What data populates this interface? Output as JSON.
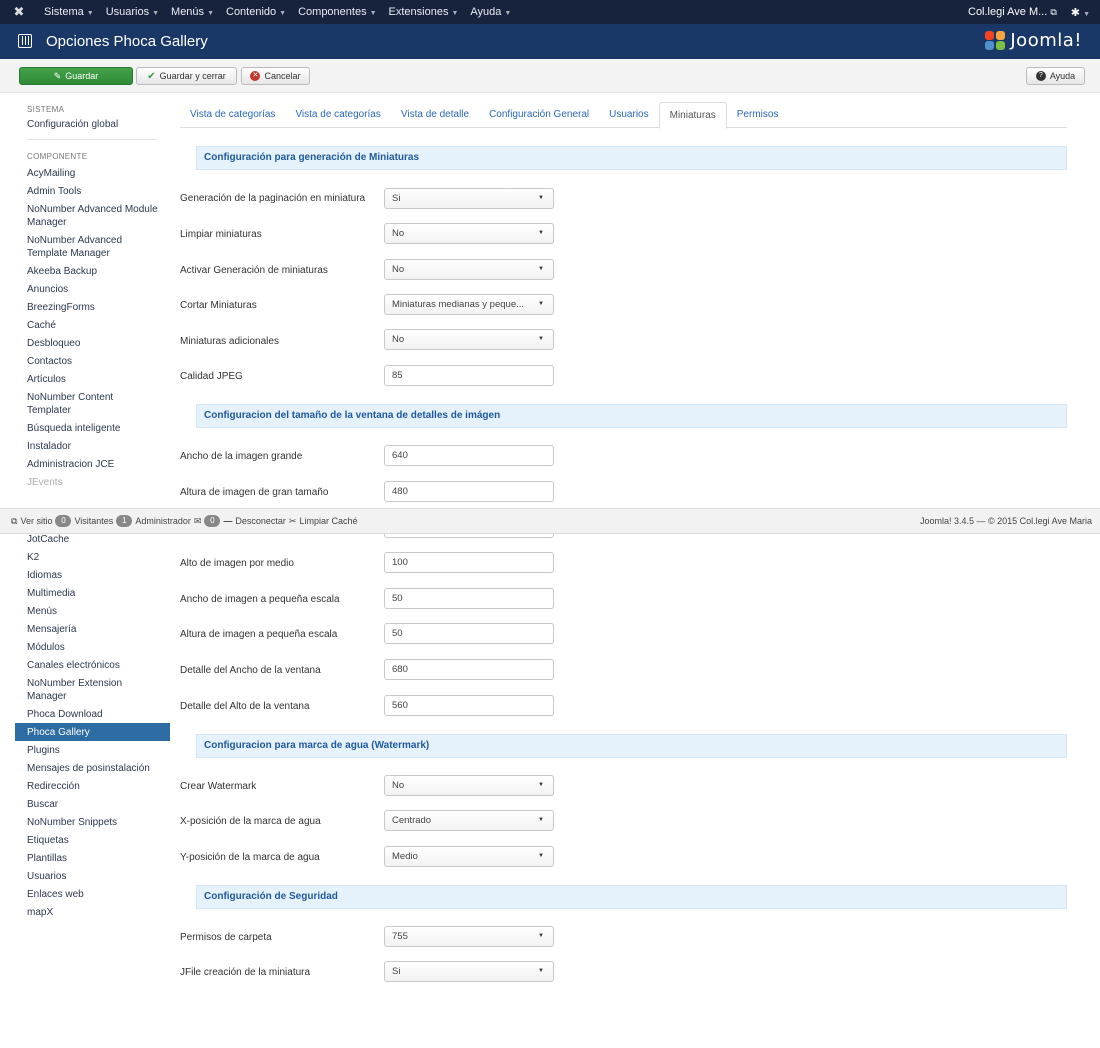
{
  "navbar": {
    "menu": [
      "Sistema",
      "Usuarios",
      "Menús",
      "Contenido",
      "Componentes",
      "Extensiones",
      "Ayuda"
    ],
    "site_name": "Col.legi Ave M...",
    "site_icon": "external-link-icon",
    "settings_icon": "gear-icon"
  },
  "header": {
    "title": "Opciones Phoca Gallery",
    "logo_text": "Joomla!"
  },
  "toolbar": {
    "save": "Guardar",
    "save_close": "Guardar y cerrar",
    "cancel": "Cancelar",
    "help": "Ayuda"
  },
  "sidebar": {
    "system_heading": "SISTEMA",
    "system_items": [
      "Configuración global"
    ],
    "component_heading": "COMPONENTE",
    "items_top": [
      "AcyMailing",
      "Admin Tools",
      "NoNumber Advanced Module Manager",
      "NoNumber Advanced Template Manager",
      "Akeeba Backup",
      "Anuncios",
      "BreezingForms",
      "Caché",
      "Desbloqueo",
      "Contactos",
      "Artículos",
      "NoNumber Content Templater",
      "Búsqueda inteligente",
      "Instalador",
      "Administracion JCE",
      "JEvents"
    ],
    "items_bottom": [
      "JotCache",
      "K2",
      "Idiomas",
      "Multimedia",
      "Menús",
      "Mensajería",
      "Módulos",
      "Canales electrónicos",
      "NoNumber Extension Manager",
      "Phoca Download",
      "Phoca Gallery",
      "Plugins",
      "Mensajes de posinstalación",
      "Redirección",
      "Buscar",
      "NoNumber Snippets",
      "Etiquetas",
      "Plantillas",
      "Usuarios",
      "Enlaces web",
      "mapX"
    ],
    "active": "Phoca Gallery"
  },
  "tabs": [
    "Vista de categorías",
    "Vista de categorías",
    "Vista de detalle",
    "Configuración General",
    "Usuarios",
    "Miniaturas",
    "Permisos"
  ],
  "active_tab": "Miniaturas",
  "sections": {
    "s1": "Configuración para generación de Miniaturas",
    "s2": "Configuracion del tamaño de la ventana de detalles de imágen",
    "s3": "Configuracion para marca de agua (Watermark)",
    "s4": "Configuración de Seguridad"
  },
  "fields": {
    "gen_paginacion": {
      "label": "Generación de la paginación en miniatura",
      "value": "Si"
    },
    "limpiar": {
      "label": "Limpiar miniaturas",
      "value": "No"
    },
    "activar_gen": {
      "label": "Activar Generación de miniaturas",
      "value": "No"
    },
    "cortar": {
      "label": "Cortar Miniaturas",
      "value": "Miniaturas medianas y peque..."
    },
    "adicionales": {
      "label": "Miniaturas adicionales",
      "value": "No"
    },
    "calidad": {
      "label": "Calidad JPEG",
      "value": "85"
    },
    "ancho_grande": {
      "label": "Ancho de la imagen grande",
      "value": "640"
    },
    "alto_grande": {
      "label": "Altura de imagen de gran tamaño",
      "value": "480"
    },
    "alto_medio": {
      "label": "Alto de imagen por medio",
      "value": "100"
    },
    "ancho_peq": {
      "label": "Ancho de imagen a pequeña escala",
      "value": "50"
    },
    "alto_peq": {
      "label": "Altura de imagen a pequeña escala",
      "value": "50"
    },
    "det_ancho": {
      "label": "Detalle del Ancho de la ventana",
      "value": "680"
    },
    "det_alto": {
      "label": "Detalle del Alto de la ventana",
      "value": "560"
    },
    "crear_wm": {
      "label": "Crear Watermark",
      "value": "No"
    },
    "x_wm": {
      "label": "X-posición de la marca de agua",
      "value": "Centrado"
    },
    "y_wm": {
      "label": "Y-posición de la marca de agua",
      "value": "Medio"
    },
    "permisos": {
      "label": "Permisos de carpeta",
      "value": "755"
    },
    "jfile": {
      "label": "JFile creación de la miniatura",
      "value": "Si"
    }
  },
  "statusbar": {
    "view_site": "Ver sitio",
    "visitors_count": "0",
    "visitors": "Visitantes",
    "admin_count": "1",
    "admin": "Administrador",
    "messages_count": "0",
    "logout": "Desconectar",
    "clear_cache": "Limpiar Caché",
    "version": "Joomla! 3.4.5 — © 2015 Col.legi Ave Maria"
  }
}
